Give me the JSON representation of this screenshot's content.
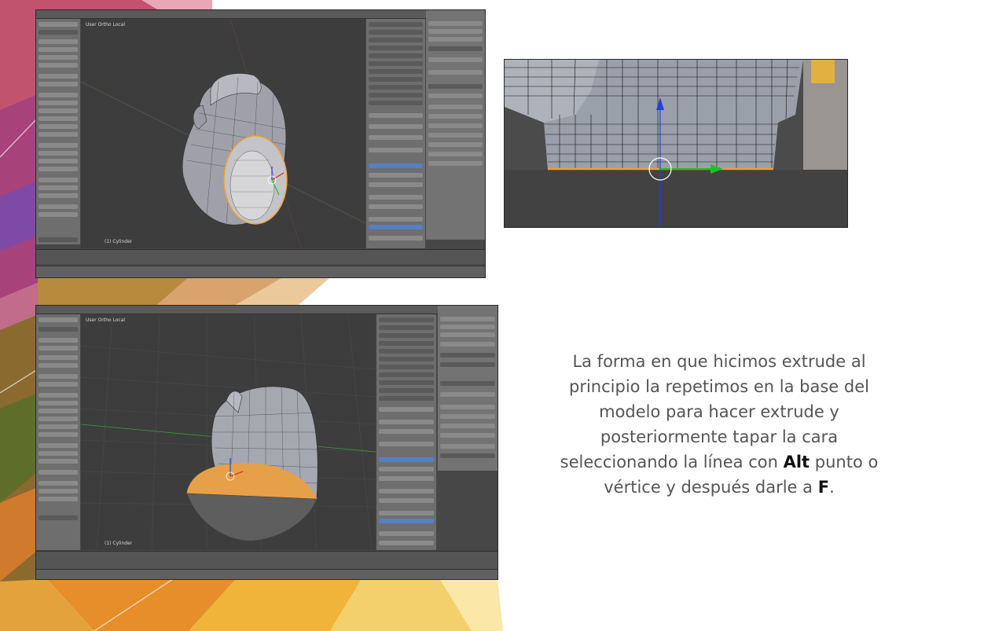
{
  "screenshot_top_left": {
    "viewport_label": "User Ortho Local",
    "object_label": "(1) Cylinder"
  },
  "screenshot_bottom_left": {
    "viewport_label": "User Ortho Local",
    "object_label": "(1) Cylinder"
  },
  "caption": {
    "line1": "La forma en que hicimos extrude al",
    "line2": "principio la repetimos en la base del",
    "line3": "modelo para hacer extrude y",
    "line4": "posteriormente tapar la cara",
    "line5_before": "seleccionando la línea con ",
    "line5_bold": "Alt",
    "line5_after": " punto o",
    "line6_before": "vértice y después darle a ",
    "line6_bold": "F",
    "line6_after": "."
  },
  "colors": {
    "caption_text": "#555555",
    "caption_emphasis": "#111111",
    "selection_orange": "#f0a030",
    "gizmo_blue": "#2040e0",
    "gizmo_green": "#20c020",
    "gizmo_red": "#e02020"
  }
}
